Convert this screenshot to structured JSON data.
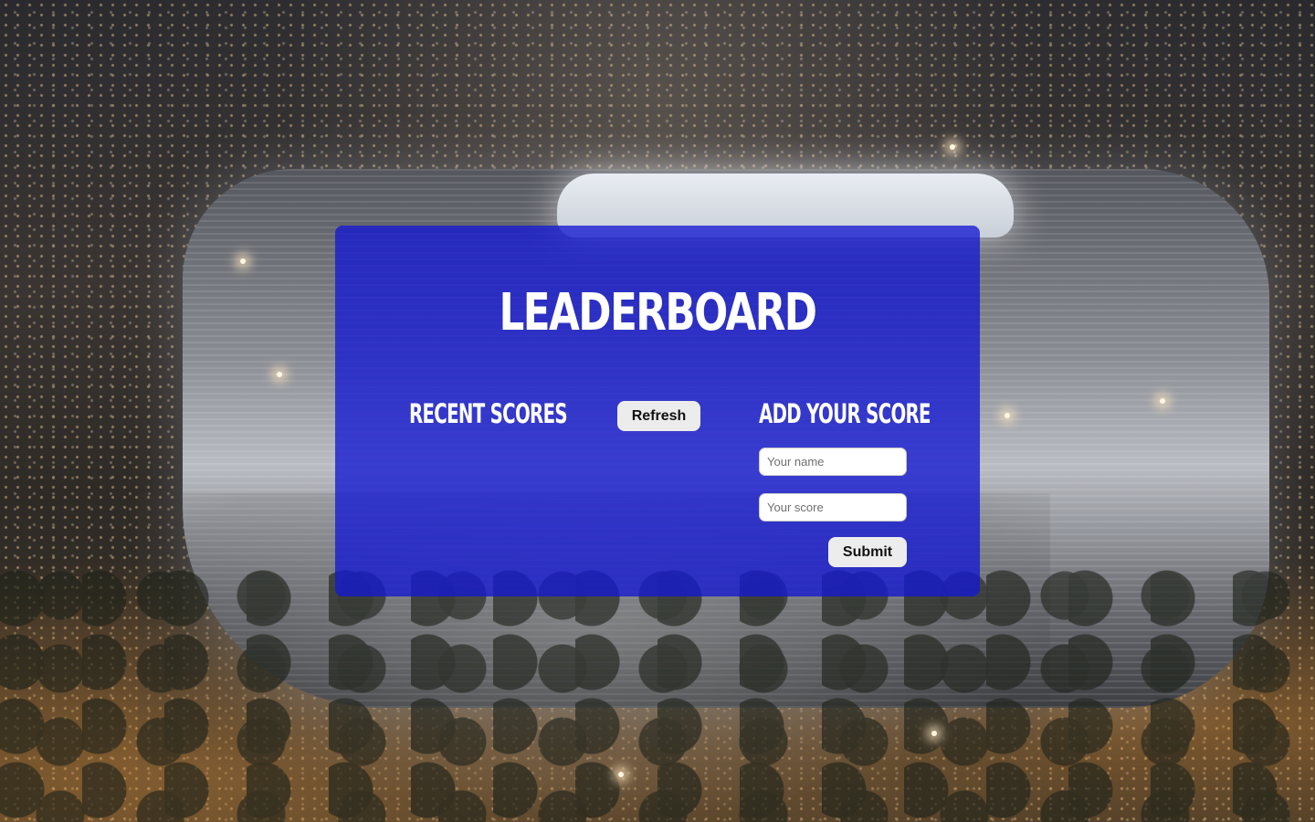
{
  "page": {
    "title": "Leaderboard"
  },
  "recent": {
    "heading": "Recent Scores",
    "refresh_label": "Refresh",
    "entries": []
  },
  "add": {
    "heading": "Add your score",
    "name_placeholder": "Your name",
    "name_value": "",
    "score_placeholder": "Your score",
    "score_value": "",
    "submit_label": "Submit"
  },
  "colors": {
    "panel": "#1418d2",
    "button_bg": "#ececec",
    "heading_text": "#ffffff"
  }
}
